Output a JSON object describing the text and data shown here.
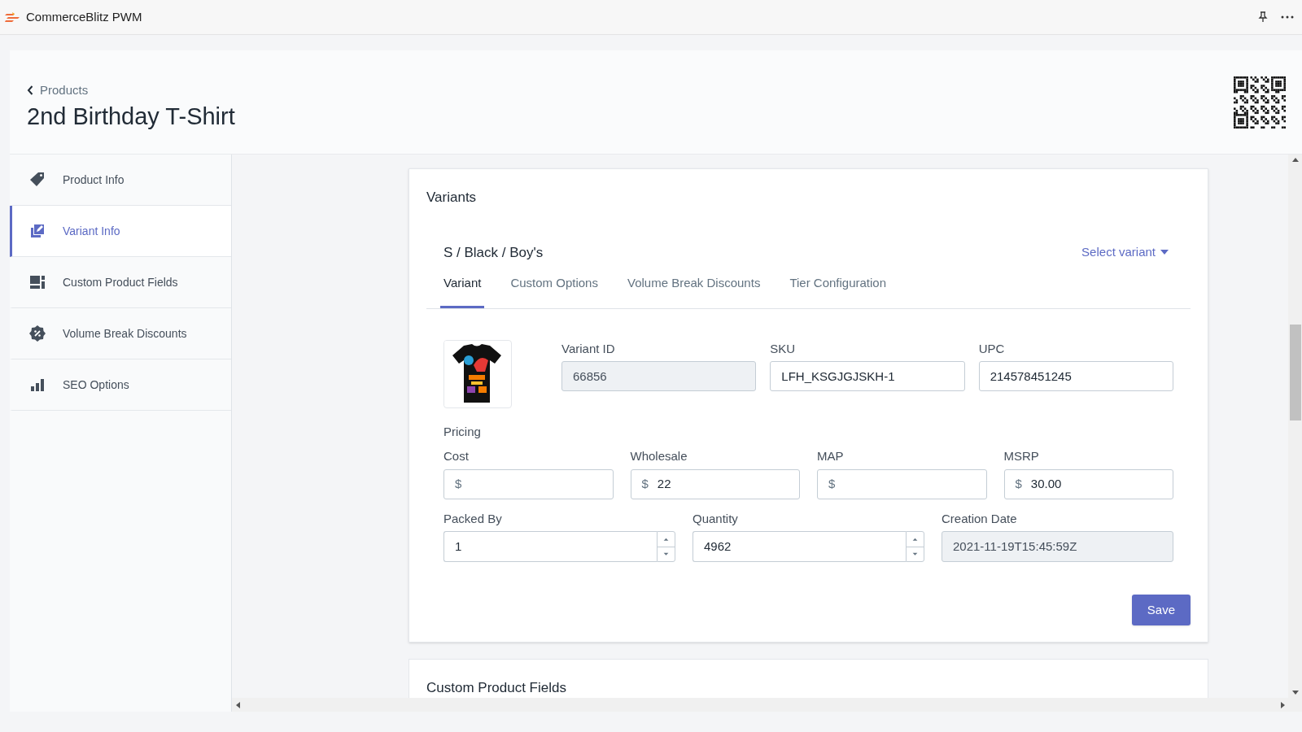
{
  "app": {
    "title": "CommerceBlitz PWM"
  },
  "header": {
    "back_link": "Products",
    "title": "2nd Birthday T-Shirt"
  },
  "sidebar": {
    "items": [
      {
        "label": "Product Info",
        "selected": false
      },
      {
        "label": "Variant Info",
        "selected": true
      },
      {
        "label": "Custom Product Fields",
        "selected": false
      },
      {
        "label": "Volume Break Discounts",
        "selected": false
      },
      {
        "label": "SEO Options",
        "selected": false
      }
    ]
  },
  "variants_card": {
    "title": "Variants",
    "variant_name": "S / Black / Boy's",
    "select_variant": "Select variant",
    "tabs": [
      {
        "label": "Variant",
        "selected": true
      },
      {
        "label": "Custom Options",
        "selected": false
      },
      {
        "label": "Volume Break Discounts",
        "selected": false
      },
      {
        "label": "Tier Configuration",
        "selected": false
      }
    ],
    "id_fields": [
      {
        "label": "Variant ID",
        "value": "66856",
        "disabled": true
      },
      {
        "label": "SKU",
        "value": "LFH_KSGJGJSKH-1",
        "disabled": false
      },
      {
        "label": "UPC",
        "value": "214578451245",
        "disabled": false
      }
    ],
    "pricing_label": "Pricing",
    "pricing_fields": [
      {
        "label": "Cost",
        "prefix": "$"
      },
      {
        "label": "Wholesale",
        "prefix": "$",
        "value": "22"
      },
      {
        "label": "MAP",
        "prefix": "$"
      },
      {
        "label": "MSRP",
        "prefix": "$",
        "value": "30.00"
      }
    ],
    "stock_fields": [
      {
        "label": "Packed By",
        "value": "1",
        "kind": "number",
        "disabled": false
      },
      {
        "label": "Quantity",
        "value": "4962",
        "kind": "number",
        "disabled": false
      },
      {
        "label": "Creation Date",
        "value": "2021-11-19T15:45:59Z",
        "kind": "text",
        "disabled": true
      }
    ],
    "save_button": "Save"
  },
  "custom_fields_card": {
    "title": "Custom Product Fields"
  }
}
